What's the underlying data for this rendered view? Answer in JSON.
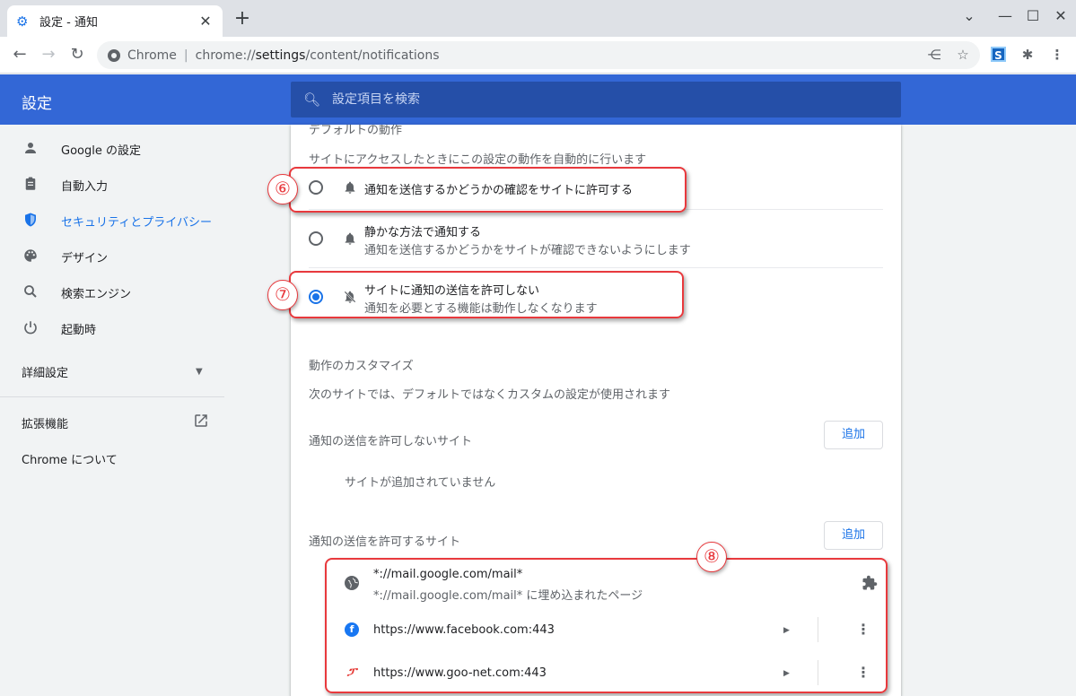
{
  "browser": {
    "tab_title": "設定 - 通知",
    "tab_close": "✕",
    "new_tab": "+",
    "omnibox_chip": "Chrome",
    "url_scheme": "chrome://",
    "url_host": "settings",
    "url_path": "/content/notifications"
  },
  "header": {
    "title": "設定",
    "search_placeholder": "設定項目を検索"
  },
  "sidebar": {
    "items": [
      {
        "label": "Google の設定",
        "icon": "person-icon"
      },
      {
        "label": "自動入力",
        "icon": "clipboard-icon"
      },
      {
        "label": "セキュリティとプライバシー",
        "icon": "shield-icon"
      },
      {
        "label": "デザイン",
        "icon": "palette-icon"
      },
      {
        "label": "検索エンジン",
        "icon": "search-icon"
      },
      {
        "label": "起動時",
        "icon": "power-icon"
      }
    ],
    "advanced": "詳細設定",
    "extensions": "拡張機能",
    "about": "Chrome について"
  },
  "main": {
    "default_heading": "デフォルトの動作",
    "default_desc": "サイトにアクセスしたときにこの設定の動作を自動的に行います",
    "options": [
      {
        "label": "通知を送信するかどうかの確認をサイトに許可する",
        "sub": "",
        "selected": false
      },
      {
        "label": "静かな方法で通知する",
        "sub": "通知を送信するかどうかをサイトが確認できないようにします",
        "selected": false
      },
      {
        "label": "サイトに通知の送信を許可しない",
        "sub": "通知を必要とする機能は動作しなくなります",
        "selected": true
      }
    ],
    "custom_heading": "動作のカスタマイズ",
    "custom_desc": "次のサイトでは、デフォルトではなくカスタムの設定が使用されます",
    "block_heading": "通知の送信を許可しないサイト",
    "add_label": "追加",
    "no_sites": "サイトが追加されていません",
    "allow_heading": "通知の送信を許可するサイト",
    "allowed_sites": [
      {
        "url": "*://mail.google.com/mail*",
        "sub": "*://mail.google.com/mail* に埋め込まれたページ"
      },
      {
        "url": "https://www.facebook.com:443",
        "sub": ""
      },
      {
        "url": "https://www.goo-net.com:443",
        "sub": ""
      }
    ]
  },
  "annotations": {
    "n6": "⑥",
    "n7": "⑦",
    "n8": "⑧",
    "color": "#e8393d"
  },
  "colors": {
    "accent": "#1a73e8",
    "header": "#3367d6"
  }
}
